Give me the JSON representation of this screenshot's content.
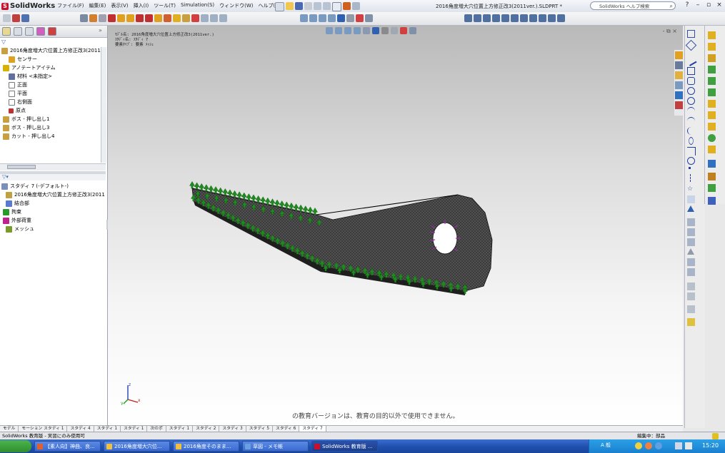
{
  "titlebar": {
    "app_name": "SolidWorks",
    "menus": [
      "ファイル(F)",
      "編集(E)",
      "表示(V)",
      "挿入(I)",
      "ツール(T)",
      "Simulation(S)",
      "ウィンドウ(W)",
      "ヘルプ(H)"
    ],
    "document_title": "2016角度増大穴位置上方修正改3(2011ver.).SLDPRT *",
    "help_search_placeholder": "SolidWorks ヘルプ検索"
  },
  "feature_tree": {
    "root": "2016角度増大穴位置上方修正改3(2011",
    "items": [
      {
        "label": "センサー",
        "icon_color": "#e0a020"
      },
      {
        "label": "アノテートアイテム",
        "icon_color": "#d8b000"
      },
      {
        "label": "材料 <未指定>",
        "icon_color": "#6070a0"
      },
      {
        "label": "正面",
        "icon_color": "#7a7a7a"
      },
      {
        "label": "平面",
        "icon_color": "#7a7a7a"
      },
      {
        "label": "右側面",
        "icon_color": "#7a7a7a"
      },
      {
        "label": "原点",
        "icon_color": "#c03030"
      },
      {
        "label": "ボス - 押し出し1",
        "icon_color": "#c8a040"
      },
      {
        "label": "ボス - 押し出し3",
        "icon_color": "#c8a040"
      },
      {
        "label": "カット - 押し出し4",
        "icon_color": "#c8a040"
      }
    ]
  },
  "study_tree": {
    "root": "スタディ 7 (-デフォルト-)",
    "items": [
      {
        "label": "2016角度増大穴位置上方修正改3(2011",
        "icon_color": "#c0a040"
      },
      {
        "label": "結合部",
        "icon_color": "#5a7ad0"
      },
      {
        "label": "拘束",
        "icon_color": "#2a9a2a"
      },
      {
        "label": "外部荷重",
        "icon_color": "#c02090"
      },
      {
        "label": "メッシュ",
        "icon_color": "#7a9a2a"
      }
    ]
  },
  "viewport": {
    "info_lines": [
      "ﾓﾃﾞﾙ名: 2016角度増大穴位置上方修正改3(2011ver.)",
      "ｽﾀﾃﾞｨ名: ｽﾀﾃﾞｨ 7",
      "要素ﾀｲﾌﾟ: 要素 ﾒｯｼｭ"
    ],
    "edu_notice": "の教育バージョンは、教育の目的以外で使用できません。",
    "window_controls": "- ⧉ ×",
    "triad": {
      "x": "x",
      "y": "y",
      "z": "z"
    }
  },
  "tabs": [
    "モデル",
    "モーション スタディ 1",
    "スタディ 4",
    "スタディ 1",
    "スタディ 1",
    "次のポ",
    "スタディ 1",
    "スタディ 2",
    "スタディ 3",
    "スタディ 5",
    "スタディ 6",
    "スタディ 7"
  ],
  "active_tab_index": 11,
  "status": {
    "left": "SolidWorks 教育版 - 実習にのみ使用可",
    "right": "編集中：部品"
  },
  "taskbar": {
    "tasks": [
      {
        "label": "【素人向】神曲、良...",
        "color": "#e06030"
      },
      {
        "label": "2016角度増大穴位...",
        "color": "#f0c040"
      },
      {
        "label": "2016角度そのまま...",
        "color": "#f0c040"
      },
      {
        "label": "草図 - メモ帳",
        "color": "#6aa0e0"
      },
      {
        "label": "SolidWorks 教育版 ...",
        "color": "#c8102e"
      }
    ],
    "active_task_index": 4,
    "tray_lang": "A 般",
    "clock": "15:20"
  },
  "colors": {
    "mesh": "#2a2a2a",
    "fixture": "#1f8a1f",
    "load": "#9a2a9a"
  }
}
